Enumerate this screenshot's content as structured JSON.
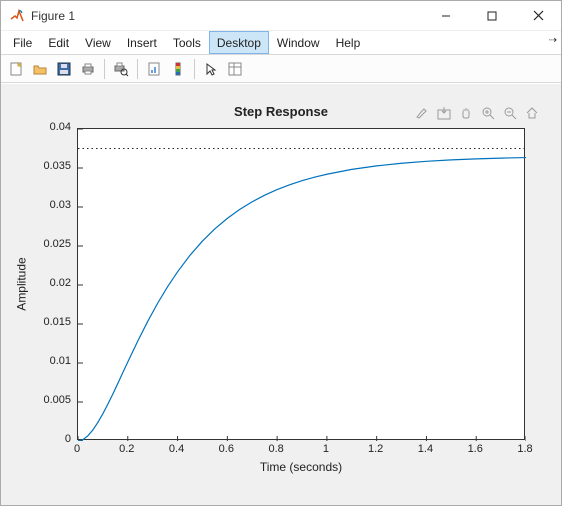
{
  "window": {
    "title": "Figure 1",
    "min_label": "Minimize",
    "max_label": "Maximize",
    "close_label": "Close"
  },
  "menubar": {
    "items": [
      "File",
      "Edit",
      "View",
      "Insert",
      "Tools",
      "Desktop",
      "Window",
      "Help"
    ],
    "active_index": 5
  },
  "toolbar": {
    "items": [
      {
        "name": "new-figure-icon",
        "title": "New Figure"
      },
      {
        "name": "open-icon",
        "title": "Open"
      },
      {
        "name": "save-icon",
        "title": "Save"
      },
      {
        "name": "print-icon",
        "title": "Print"
      }
    ],
    "items2": [
      {
        "name": "print-preview-icon",
        "title": "Print Preview"
      }
    ],
    "items3": [
      {
        "name": "link-plot-icon",
        "title": "Link Plot"
      },
      {
        "name": "colorbar-icon",
        "title": "Insert Colorbar"
      }
    ],
    "items4": [
      {
        "name": "cursor-icon",
        "title": "Edit Plot"
      },
      {
        "name": "property-inspector-icon",
        "title": "Open Property Inspector"
      }
    ]
  },
  "axes_toolbar_icons": [
    "brush-icon",
    "export-icon",
    "pan-icon",
    "zoom-in-icon",
    "zoom-out-icon",
    "home-icon"
  ],
  "chart_data": {
    "type": "line",
    "title": "Step Response",
    "xlabel": "Time (seconds)",
    "ylabel": "Amplitude",
    "xlim": [
      0,
      1.8
    ],
    "ylim": [
      0,
      0.04
    ],
    "xticks": [
      0,
      0.2,
      0.4,
      0.6,
      0.8,
      1,
      1.2,
      1.4,
      1.6,
      1.8
    ],
    "yticks": [
      0,
      0.005,
      0.01,
      0.015,
      0.02,
      0.025,
      0.03,
      0.035,
      0.04
    ],
    "steady_state": 0.0375,
    "series": [
      {
        "name": "response",
        "color": "#0072BD",
        "x": [
          0,
          0.02,
          0.04,
          0.06,
          0.08,
          0.1,
          0.12,
          0.14,
          0.16,
          0.18,
          0.2,
          0.24,
          0.28,
          0.32,
          0.36,
          0.4,
          0.45,
          0.5,
          0.55,
          0.6,
          0.65,
          0.7,
          0.75,
          0.8,
          0.85,
          0.9,
          0.95,
          1.0,
          1.1,
          1.2,
          1.3,
          1.4,
          1.5,
          1.6,
          1.7,
          1.8
        ],
        "y": [
          0,
          0.00018,
          0.00068,
          0.00143,
          0.00239,
          0.0035,
          0.00473,
          0.00603,
          0.00738,
          0.00876,
          0.01013,
          0.0128,
          0.01533,
          0.01766,
          0.01979,
          0.02169,
          0.02381,
          0.02563,
          0.0272,
          0.02854,
          0.02969,
          0.03067,
          0.03151,
          0.03223,
          0.03284,
          0.03337,
          0.03382,
          0.0342,
          0.03482,
          0.03527,
          0.03561,
          0.03586,
          0.03604,
          0.03617,
          0.03627,
          0.03634
        ]
      }
    ]
  }
}
